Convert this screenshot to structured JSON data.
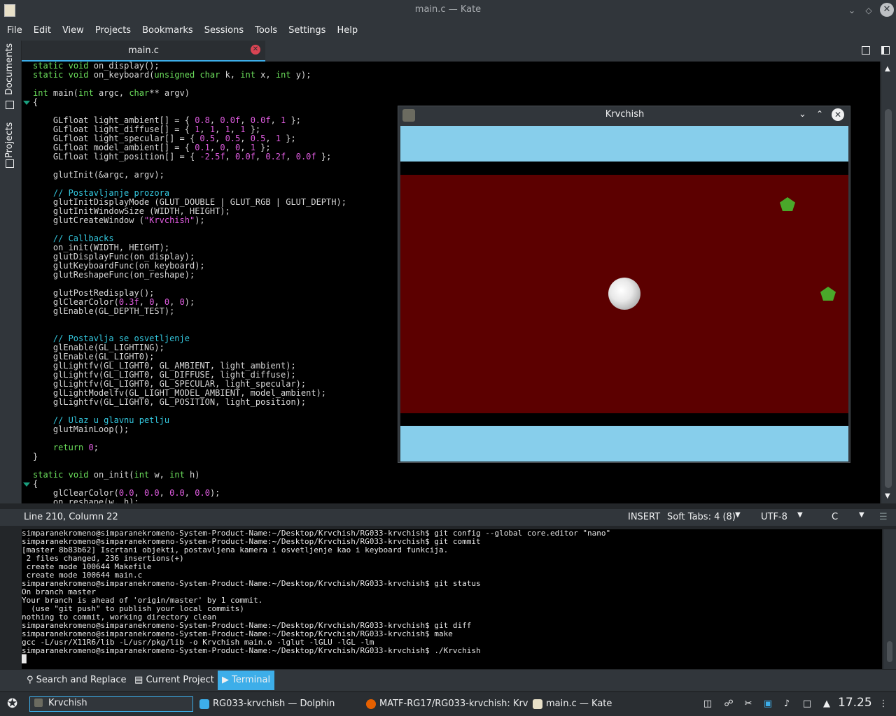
{
  "window": {
    "title": "main.c  — Kate"
  },
  "menubar": [
    "File",
    "Edit",
    "View",
    "Projects",
    "Bookmarks",
    "Sessions",
    "Tools",
    "Settings",
    "Help"
  ],
  "side_panel": {
    "documents": "Documents",
    "projects": "Projects"
  },
  "tabs": [
    {
      "label": "main.c"
    }
  ],
  "code_lines": [
    "static void on_display();",
    "static void on_keyboard(unsigned char k, int x, int y);",
    "",
    "int main(int argc, char** argv)",
    "{",
    "",
    "    GLfloat light_ambient[] = { 0.8, 0.0f, 0.0f, 1 };",
    "    GLfloat light_diffuse[] = { 1, 1, 1, 1 };",
    "    GLfloat light_specular[] = { 0.5, 0.5, 0.5, 1 };",
    "    GLfloat model_ambient[] = { 0.1, 0, 0, 1 };",
    "    GLfloat light_position[] = { -2.5f, 0.0f, 0.2f, 0.0f };",
    "",
    "    glutInit(&argc, argv);",
    "",
    "    // Postavljanje prozora",
    "    glutInitDisplayMode (GLUT_DOUBLE | GLUT_RGB | GLUT_DEPTH);",
    "    glutInitWindowSize (WIDTH, HEIGHT);",
    "    glutCreateWindow (\"Krvchish\");",
    "",
    "    // Callbacks",
    "    on_init(WIDTH, HEIGHT);",
    "    glutDisplayFunc(on_display);",
    "    glutKeyboardFunc(on_keyboard);",
    "    glutReshapeFunc(on_reshape);",
    "",
    "    glutPostRedisplay();",
    "    glClearColor(0.3f, 0, 0, 0);",
    "    glEnable(GL_DEPTH_TEST);",
    "",
    "",
    "    // Postavlja se osvetljenje",
    "    glEnable(GL_LIGHTING);",
    "    glEnable(GL_LIGHT0);",
    "    glLightfv(GL_LIGHT0, GL_AMBIENT, light_ambient);",
    "    glLightfv(GL_LIGHT0, GL_DIFFUSE, light_diffuse);",
    "    glLightfv(GL_LIGHT0, GL_SPECULAR, light_specular);",
    "    glLightModelfv(GL_LIGHT_MODEL_AMBIENT, model_ambient);",
    "    glLightfv(GL_LIGHT0, GL_POSITION, light_position);",
    "",
    "    // Ulaz u glavnu petlju",
    "    glutMainLoop();",
    "",
    "    return 0;",
    "}",
    "",
    "static void on_init(int w, int h)",
    "{",
    "    glClearColor(0.0, 0.0, 0.0, 0.0);",
    "    on_reshape(w, h);"
  ],
  "gl_window": {
    "title": "Krvchish"
  },
  "statusbar": {
    "position": "Line 210, Column 22",
    "mode": "INSERT",
    "indent": "Soft Tabs: 4 (8)",
    "encoding": "UTF-8",
    "syntax": "C"
  },
  "terminal_lines": [
    "simparanekromeno@simparanekromeno-System-Product-Name:~/Desktop/Krvchish/RG033-krvchish$ git config --global core.editor \"nano\"",
    "simparanekromeno@simparanekromeno-System-Product-Name:~/Desktop/Krvchish/RG033-krvchish$ git commit",
    "[master 8b83b62] Iscrtani objekti, postavljena kamera i osvetljenje kao i keyboard funkcija.",
    " 2 files changed, 236 insertions(+)",
    " create mode 100644 Makefile",
    " create mode 100644 main.c",
    "simparanekromeno@simparanekromeno-System-Product-Name:~/Desktop/Krvchish/RG033-krvchish$ git status",
    "On branch master",
    "Your branch is ahead of 'origin/master' by 1 commit.",
    "  (use \"git push\" to publish your local commits)",
    "nothing to commit, working directory clean",
    "simparanekromeno@simparanekromeno-System-Product-Name:~/Desktop/Krvchish/RG033-krvchish$ git diff",
    "simparanekromeno@simparanekromeno-System-Product-Name:~/Desktop/Krvchish/RG033-krvchish$ make",
    "gcc -L/usr/X11R6/lib -L/usr/pkg/lib -o Krvchish main.o -lglut -lGLU -lGL -lm",
    "simparanekromeno@simparanekromeno-System-Product-Name:~/Desktop/Krvchish/RG033-krvchish$ ./Krvchish"
  ],
  "tool_tabs": {
    "search": "Search and Replace",
    "project": "Current Project",
    "terminal": "Terminal"
  },
  "taskbar": {
    "search_value": "Krvchish",
    "tasks": [
      "RG033-krvchish — Dolphin",
      "MATF-RG17/RG033-krvchish: Krv",
      "main.c  — Kate"
    ],
    "clock": "17.25"
  },
  "colors": {
    "accent": "#3daee9",
    "panel": "#31363b",
    "close_tab": "#da4453",
    "field": "#5c0000",
    "sky": "#87ceeb",
    "enemy": "#4aa82a"
  }
}
